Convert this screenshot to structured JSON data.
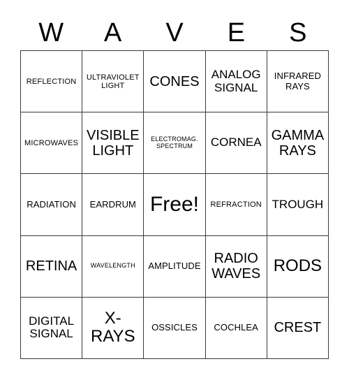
{
  "card": {
    "title_letters": [
      "W",
      "A",
      "V",
      "E",
      "S"
    ],
    "free_space_label": "Free!",
    "grid_line_color": "#3a3a3a",
    "text_color": "#000000",
    "background_color": "#ffffff",
    "rows": 5,
    "columns": 5,
    "cells": [
      [
        {
          "text": "REFLECTION",
          "size": "s"
        },
        {
          "text": "ULTRAVIOLET LIGHT",
          "size": "s"
        },
        {
          "text": "CONES",
          "size": "xl"
        },
        {
          "text": "ANALOG SIGNAL",
          "size": "l"
        },
        {
          "text": "INFRARED RAYS",
          "size": "m"
        }
      ],
      [
        {
          "text": "MICROWAVES",
          "size": "s"
        },
        {
          "text": "VISIBLE LIGHT",
          "size": "xl"
        },
        {
          "text": "ELECTROMAG. SPECTRUM",
          "size": "xs"
        },
        {
          "text": "CORNEA",
          "size": "l"
        },
        {
          "text": "GAMMA RAYS",
          "size": "xl"
        }
      ],
      [
        {
          "text": "RADIATION",
          "size": "m"
        },
        {
          "text": "EARDRUM",
          "size": "m"
        },
        {
          "text": "Free!",
          "size": "free"
        },
        {
          "text": "REFRACTION",
          "size": "s"
        },
        {
          "text": "TROUGH",
          "size": "l"
        }
      ],
      [
        {
          "text": "RETINA",
          "size": "xl"
        },
        {
          "text": "WAVELENGTH",
          "size": "xs"
        },
        {
          "text": "AMPLITUDE",
          "size": "m"
        },
        {
          "text": "RADIO WAVES",
          "size": "xl"
        },
        {
          "text": "RODS",
          "size": "xxl"
        }
      ],
      [
        {
          "text": "DIGITAL SIGNAL",
          "size": "l"
        },
        {
          "text": "X- RAYS",
          "size": "xxl"
        },
        {
          "text": "OSSICLES",
          "size": "m"
        },
        {
          "text": "COCHLEA",
          "size": "m"
        },
        {
          "text": "CREST",
          "size": "xl"
        }
      ]
    ]
  }
}
